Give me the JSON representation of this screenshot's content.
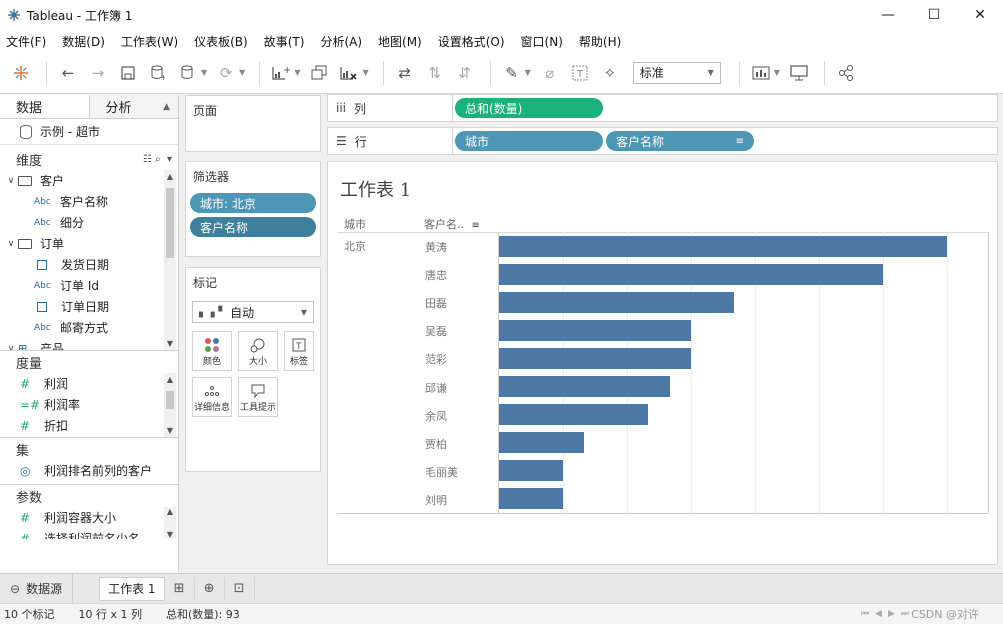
{
  "window": {
    "title": "Tableau - 工作簿 1",
    "minimize": "—",
    "maximize": "☐",
    "close": "✕"
  },
  "menu": [
    "文件(F)",
    "数据(D)",
    "工作表(W)",
    "仪表板(B)",
    "故事(T)",
    "分析(A)",
    "地图(M)",
    "设置格式(O)",
    "窗口(N)",
    "帮助(H)"
  ],
  "toolbar": {
    "fit_value": "标准"
  },
  "datapane": {
    "tab_data": "数据",
    "tab_analysis": "分析",
    "datasource": "示例 - 超市",
    "dimensions_title": "维度",
    "dimensions": [
      {
        "type": "folder",
        "label": "客户"
      },
      {
        "type": "abc",
        "label": "客户名称"
      },
      {
        "type": "abc",
        "label": "细分"
      },
      {
        "type": "folder",
        "label": "订单"
      },
      {
        "type": "date",
        "label": "发货日期"
      },
      {
        "type": "abc",
        "label": "订单 Id"
      },
      {
        "type": "date",
        "label": "订单日期"
      },
      {
        "type": "abc",
        "label": "邮寄方式"
      },
      {
        "type": "folder",
        "label": "产品"
      }
    ],
    "measures_title": "度量",
    "measures": [
      "利润",
      "利润率",
      "折扣"
    ],
    "sets_title": "集",
    "sets": [
      "利润排名前列的客户"
    ],
    "params_title": "参数",
    "params": [
      "利润容器大小",
      "选择利润前名少名"
    ]
  },
  "cards": {
    "pages_title": "页面",
    "filters_title": "筛选器",
    "filters": [
      "城市: 北京",
      "客户名称"
    ],
    "marks_title": "标记",
    "marks_type": "自动",
    "mark_buttons": [
      "颜色",
      "大小",
      "标签",
      "详细信息",
      "工具提示"
    ]
  },
  "shelves": {
    "columns_label": "列",
    "columns_pills": [
      "总和(数量)"
    ],
    "rows_label": "行",
    "rows_pills": [
      "城市",
      "客户名称"
    ]
  },
  "view": {
    "sheet_title": "工作表 1",
    "header_city": "城市",
    "header_customer": "客户名..",
    "city": "北京"
  },
  "chart_data": {
    "type": "bar",
    "orientation": "horizontal",
    "title": "工作表 1",
    "row_headers": [
      "城市",
      "客户名称"
    ],
    "city": "北京",
    "categories": [
      "黄涛",
      "唐忠",
      "田磊",
      "吴磊",
      "范彩",
      "邱谦",
      "余凤",
      "贾柏",
      "毛丽美",
      "刘明"
    ],
    "values": [
      21,
      18,
      11,
      9,
      9,
      8,
      7,
      4,
      3,
      3
    ],
    "xlim": [
      0,
      23
    ],
    "measure": "总和(数量)",
    "color": "#4e79a7",
    "grid": true
  },
  "sheetbar": {
    "datasource_tab": "数据源",
    "sheet_tab": "工作表 1"
  },
  "status": {
    "marks": "10 个标记",
    "dims": "10 行 x 1 列",
    "sum": "总和(数量): 93",
    "watermark": "CSDN @对许"
  }
}
